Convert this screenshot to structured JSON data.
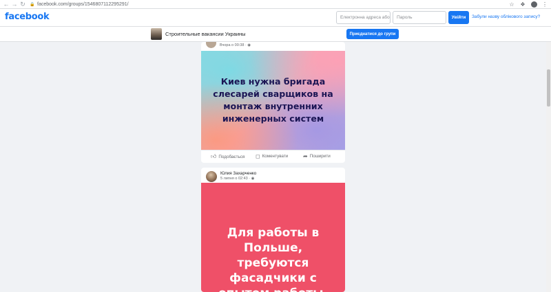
{
  "browser": {
    "url": "facebook.com/groups/1546807112295291/",
    "icons": {
      "back": "arrow-left-icon",
      "forward": "arrow-right-icon",
      "reload": "reload-icon",
      "lock": "lock-icon",
      "star": "star-icon",
      "extensions": "puzzle-icon",
      "profile": "profile-icon",
      "menu": "more-vertical-icon"
    }
  },
  "header": {
    "logo": "facebook",
    "email_placeholder": "Електронна адреса або",
    "password_placeholder": "Пароль",
    "login_label": "Увійти",
    "forgot_label": "Забули назву облікового запису?"
  },
  "group": {
    "name": "Строительные вакансии Украины",
    "join_label": "Приєднатися до групи"
  },
  "posts": [
    {
      "time": "Вчора о 00:38 · ",
      "image_text": "Киев нужна бригада слесарей сварщиков на монтаж внутренних инженерных систем",
      "actions": {
        "like": "Подобається",
        "comment": "Коментувати",
        "share": "Поширити"
      }
    },
    {
      "author": "Юлия Захарченко",
      "time": "5 липня о 02:43 · ",
      "image_text": "Для работы в Польше, требуются фасадчики с опытом работы. Для большей",
      "image_bg": "#ef5068"
    }
  ],
  "colors": {
    "brand": "#1877f2",
    "page_bg": "#f0f2f5"
  }
}
